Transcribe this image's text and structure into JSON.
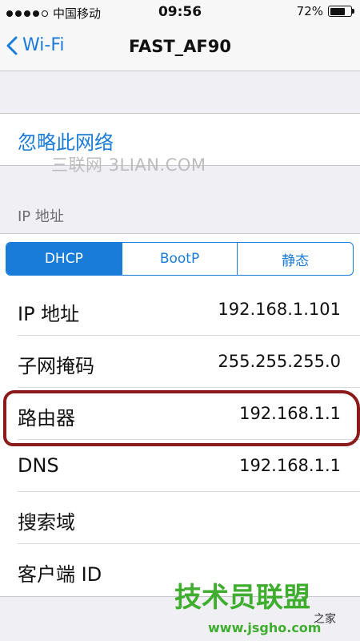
{
  "status_bar": {
    "carrier": "中国移动",
    "time": "09:56",
    "battery_percent": "72%",
    "battery_level": 0.72,
    "signal_bars_filled": 4,
    "signal_bars_total": 5
  },
  "nav": {
    "back_label": "Wi-Fi",
    "title": "FAST_AF90",
    "accent_color": "#1a7cd9"
  },
  "forget_network": {
    "label": "忽略此网络"
  },
  "watermark_top": "三联网 3LIAN.COM",
  "ip_section": {
    "header": "IP 地址",
    "modes": [
      {
        "label": "DHCP",
        "selected": true
      },
      {
        "label": "BootP",
        "selected": false
      },
      {
        "label": "静态",
        "selected": false
      }
    ],
    "rows": [
      {
        "label": "IP 地址",
        "value": "192.168.1.101"
      },
      {
        "label": "子网掩码",
        "value": "255.255.255.0"
      },
      {
        "label": "路由器",
        "value": "192.168.1.1"
      },
      {
        "label": "DNS",
        "value": "192.168.1.1"
      },
      {
        "label": "搜索域",
        "value": ""
      },
      {
        "label": "客户端 ID",
        "value": ""
      }
    ]
  },
  "watermark_bottom": {
    "title": "技术员联盟",
    "suffix": "之家",
    "url": "www.jsgho.com"
  }
}
